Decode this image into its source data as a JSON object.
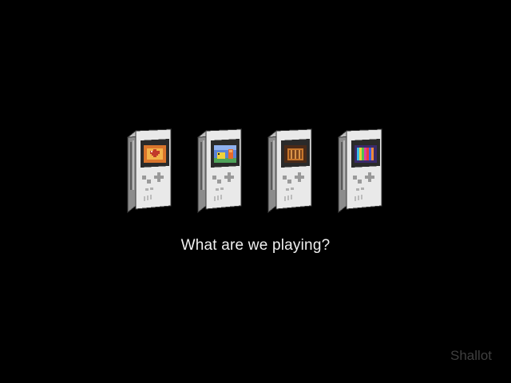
{
  "prompt": "What are we playing?",
  "brand": "Shallot",
  "colors": {
    "background": "#000000",
    "prompt_text": "#f0f0f0",
    "brand_text": "#3f3f3f",
    "console_body": "#e9e9e9",
    "console_shadow": "#8c8c8c",
    "console_outline": "#3a3a3a"
  },
  "consoles": [
    {
      "name": "console-red-heart",
      "icon": "heart-screen-icon",
      "screen_bg": "#d9752c",
      "accent": "#c23a2a"
    },
    {
      "name": "console-yellow-pet",
      "icon": "pet-screen-icon",
      "screen_bg": "#5b83d6",
      "accent": "#f0d23a"
    },
    {
      "name": "console-brown-crate",
      "icon": "crate-screen-icon",
      "screen_bg": "#4a2a18",
      "accent": "#c8772c"
    },
    {
      "name": "console-color-bars",
      "icon": "color-bars-screen-icon",
      "screen_bg": "#3a2a6a",
      "accent": "#e23aa0"
    }
  ]
}
